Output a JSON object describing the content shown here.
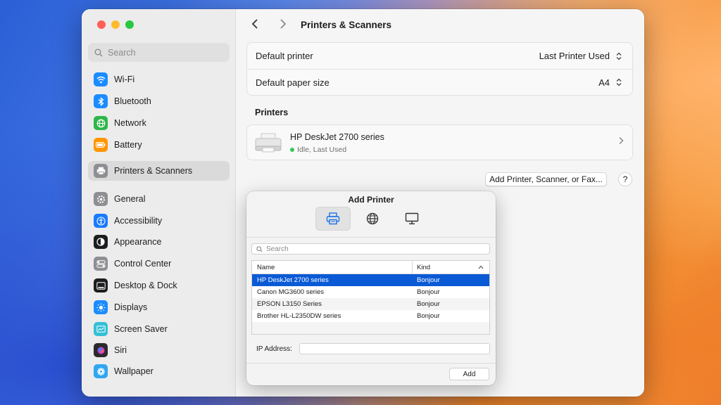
{
  "window": {
    "title": "Printers & Scanners",
    "nav_back": "‹",
    "nav_forward": "›"
  },
  "sidebar": {
    "search_placeholder": "Search",
    "items": [
      {
        "label": "Wi-Fi",
        "icon": "wifi-icon",
        "color": "#1a8cff"
      },
      {
        "label": "Bluetooth",
        "icon": "bluetooth-icon",
        "color": "#1a8cff"
      },
      {
        "label": "Network",
        "icon": "globe-icon",
        "color": "#2fb64a"
      },
      {
        "label": "Battery",
        "icon": "battery-icon",
        "color": "#ff9500"
      },
      {
        "label": "Printers & Scanners",
        "icon": "printer-icon",
        "color": "#8e8e93"
      },
      {
        "label": "General",
        "icon": "gear-icon",
        "color": "#8e8e93"
      },
      {
        "label": "Accessibility",
        "icon": "accessibility-icon",
        "color": "#1a7aff"
      },
      {
        "label": "Appearance",
        "icon": "appearance-icon",
        "color": "#1d1d1f"
      },
      {
        "label": "Control Center",
        "icon": "control-center-icon",
        "color": "#8e8e93"
      },
      {
        "label": "Desktop & Dock",
        "icon": "dock-icon",
        "color": "#1d1d1f"
      },
      {
        "label": "Displays",
        "icon": "sun-icon",
        "color": "#1a8cff"
      },
      {
        "label": "Screen Saver",
        "icon": "screen-saver-icon",
        "color": "#34c0d6"
      },
      {
        "label": "Siri",
        "icon": "siri-icon",
        "color": "#2b2b2b"
      },
      {
        "label": "Wallpaper",
        "icon": "wallpaper-icon",
        "color": "#2ea7f0"
      }
    ]
  },
  "settings": {
    "default_printer_label": "Default printer",
    "default_printer_value": "Last Printer Used",
    "default_paper_label": "Default paper size",
    "default_paper_value": "A4"
  },
  "printers": {
    "heading": "Printers",
    "name": "HP DeskJet 2700 series",
    "status": "Idle, Last Used",
    "status_color": "#34c759"
  },
  "add_button": "Add Printer, Scanner, or Fax...",
  "help_button": "?",
  "add_sheet": {
    "title": "Add Printer",
    "tabs": [
      "printer-tab-icon",
      "globe-tab-icon",
      "monitor-tab-icon"
    ],
    "search_placeholder": "Search",
    "col_name": "Name",
    "col_kind": "Kind",
    "rows": [
      {
        "name": "HP DeskJet 2700 series",
        "kind": "Bonjour"
      },
      {
        "name": "Canon MG3600 series",
        "kind": "Bonjour"
      },
      {
        "name": "EPSON L3150 Series",
        "kind": "Bonjour"
      },
      {
        "name": "Brother HL-L2350DW series",
        "kind": "Bonjour"
      }
    ],
    "ip_label": "IP Address:",
    "ip_value": "",
    "add_label": "Add",
    "selected_color": "#0a5ad6"
  }
}
